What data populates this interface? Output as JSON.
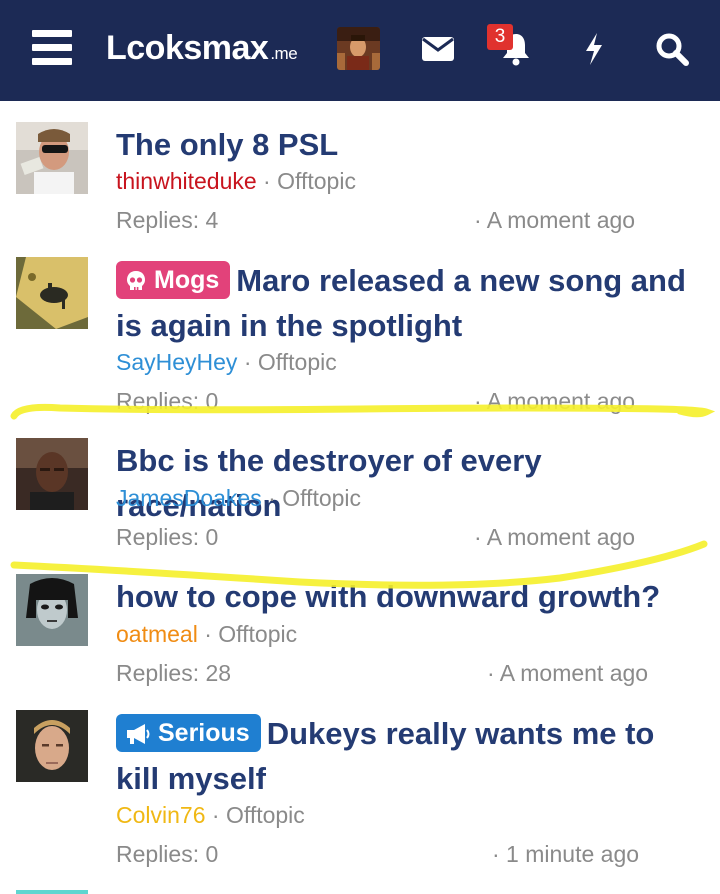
{
  "header": {
    "logo_text": "Lcoksmax",
    "logo_tld": ".me",
    "notification_count": "3",
    "icons": [
      "menu-icon",
      "envelope-icon",
      "bell-icon",
      "bolt-icon",
      "search-icon"
    ]
  },
  "colors": {
    "header_bg": "#1c2a55",
    "title": "#243b73",
    "meta": "#8a8a8a",
    "highlight": "#f5f02a"
  },
  "threads": [
    {
      "prefix": "",
      "title": "The only 8 PSL",
      "author": "thinwhiteduke",
      "author_color": "#c8141e",
      "forum": "Offtopic",
      "replies": "Replies: 4",
      "time": "· A moment ago"
    },
    {
      "prefix": "Mogs",
      "prefix_color": "#e2427a",
      "prefix_icon": "skull-icon",
      "title": "Maro released a new song and is again in the spotlight",
      "author": "SayHeyHey",
      "author_color": "#2e8fd6",
      "forum": "Offtopic",
      "replies": "Replies: 0",
      "time": "· A moment ago"
    },
    {
      "prefix": "",
      "title": "Bbc is the destroyer of every race/nation",
      "author": "JamesDoakes",
      "author_color": "#2e8fd6",
      "forum": "Offtopic",
      "replies": "Replies: 0",
      "time": "· A moment ago"
    },
    {
      "prefix": "",
      "title": "how to cope with downward growth?",
      "author": "oatmeal",
      "author_color": "#f08c14",
      "forum": "Offtopic",
      "replies": "Replies: 28",
      "time": "· A moment ago"
    },
    {
      "prefix": "Serious",
      "prefix_color": "#1f7fd1",
      "prefix_icon": "megaphone-icon",
      "title": "Dukeys really wants me to kill myself",
      "author": "Colvin76",
      "author_color": "#f0b814",
      "forum": "Offtopic",
      "replies": "Replies: 0",
      "time": "· 1 minute ago"
    }
  ]
}
